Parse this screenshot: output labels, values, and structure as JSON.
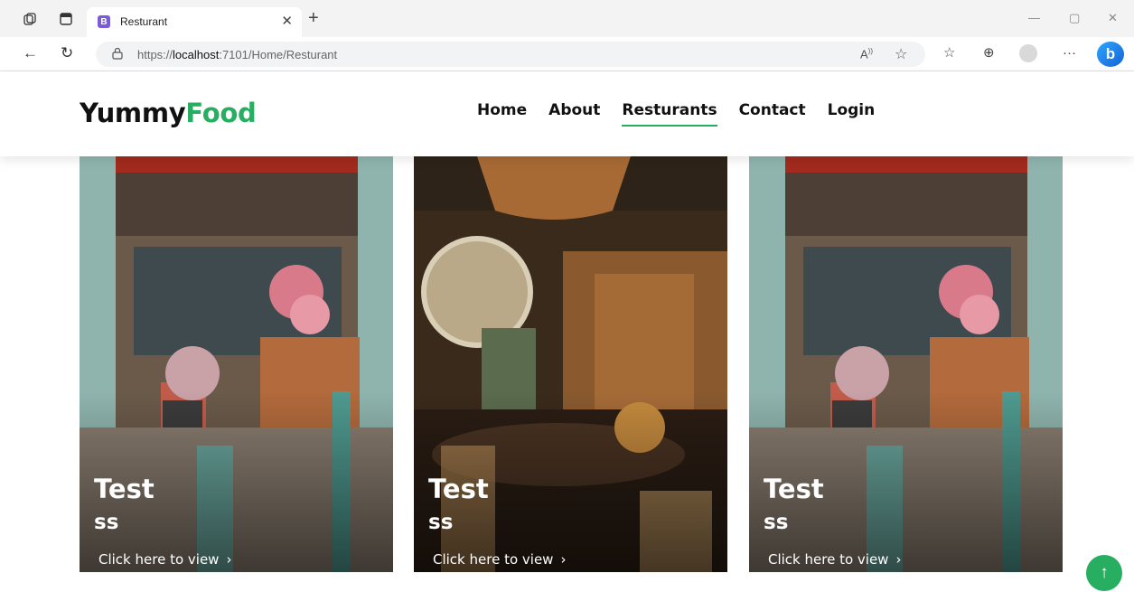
{
  "browser": {
    "tab_title": "Resturant",
    "tab_favicon_letter": "B",
    "url_prefix": "https://",
    "url_host": "localhost",
    "url_rest": ":7101/Home/Resturant",
    "read_aloud_label": "Ȃ"
  },
  "site": {
    "logo_main": "Yummy",
    "logo_accent": "Food",
    "accent_color": "#27ae60",
    "nav": [
      {
        "label": "Home"
      },
      {
        "label": "About"
      },
      {
        "label": "Resturants"
      },
      {
        "label": "Contact"
      },
      {
        "label": "Login"
      }
    ]
  },
  "cards": [
    {
      "title": "Test",
      "subtitle": "ss",
      "link": "Click here to view",
      "image": "restaurant-interior-colorful"
    },
    {
      "title": "Test",
      "subtitle": "ss",
      "link": "Click here to view",
      "image": "restaurant-interior-warm"
    },
    {
      "title": "Test",
      "subtitle": "ss",
      "link": "Click here to view",
      "image": "restaurant-interior-colorful"
    }
  ],
  "icons": {
    "back_to_top": "arrow-up-icon"
  }
}
